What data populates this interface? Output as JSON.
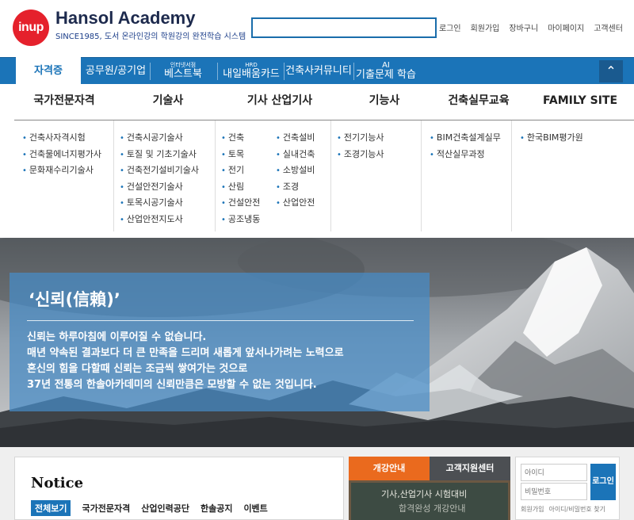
{
  "header": {
    "logo_text": "inup",
    "brand_title": "Hansol Academy",
    "brand_sub": "SINCE1985, 도서 온라인강의 학원강의 완전학습 시스템",
    "search_placeholder": "",
    "top_links": [
      "로그인",
      "회원가입",
      "장바구니",
      "마이페이지",
      "고객센터"
    ]
  },
  "nav": {
    "items": [
      {
        "label": "자격증",
        "small": ""
      },
      {
        "label": "공무원/공기업",
        "small": ""
      },
      {
        "label": "베스트북",
        "small": "인터넷서점"
      },
      {
        "label": "내일배움카드",
        "small": "HRD"
      },
      {
        "label": "건축사커뮤니티",
        "small": ""
      },
      {
        "label": "기출문제 학습",
        "small": "AI"
      }
    ],
    "toggle_icon": "chevron-up-icon"
  },
  "mega": {
    "heads": [
      "국가전문자격",
      "기술사",
      "기사 산업기사",
      "기능사",
      "건축실무교육",
      "FAMILY SITE"
    ],
    "col1": [
      "건축사자격시험",
      "건축물에너지평가사",
      "문화재수리기술사"
    ],
    "col2": [
      "건축시공기술사",
      "토질 및 기초기술사",
      "건축전기설비기술사",
      "건설안전기술사",
      "토목시공기술사",
      "산업안전지도사"
    ],
    "col3a": [
      "건축",
      "토목",
      "전기",
      "산림",
      "건설안전",
      "공조냉동"
    ],
    "col3b": [
      "건축설비",
      "실내건축",
      "소방설비",
      "조경",
      "산업안전"
    ],
    "col4": [
      "전기기능사",
      "조경기능사"
    ],
    "col5": [
      "BIM건축설계실무",
      "적산실무과정"
    ],
    "col6": [
      "한국BIM평가원"
    ]
  },
  "banner": {
    "title": "‘신뢰(信賴)’",
    "lines": [
      "신뢰는 하루아침에 이루어질 수 없습니다.",
      "매년 약속된 결과보다 더 큰 만족을 드리며 새롭게 앞서나가려는 노력으로",
      "혼신의 힘을 다할때 신뢰는 조금씩 쌓여가는 것으로",
      "37년 전통의 한솔아카데미의 신뢰만큼은 모방할 수 없는 것입니다."
    ]
  },
  "notice": {
    "title": "Notice",
    "tabs": [
      "전체보기",
      "국가전문자격",
      "산업인력공단",
      "한솔공지",
      "이벤트"
    ]
  },
  "course": {
    "tabs": [
      "개강안내",
      "고객지원센터"
    ],
    "chalk_text": "기사,산업기사 시험대비",
    "chalk_text2": "합격완성 개강안내"
  },
  "login": {
    "id_placeholder": "아이디",
    "pw_placeholder": "비밀번호",
    "button": "로그인",
    "links": [
      "회원가입",
      "아이디/비밀번호 찾기"
    ]
  },
  "colors": {
    "brand_blue": "#1b74b8",
    "logo_red": "#e5212c",
    "course_orange": "#ea6a1e"
  }
}
